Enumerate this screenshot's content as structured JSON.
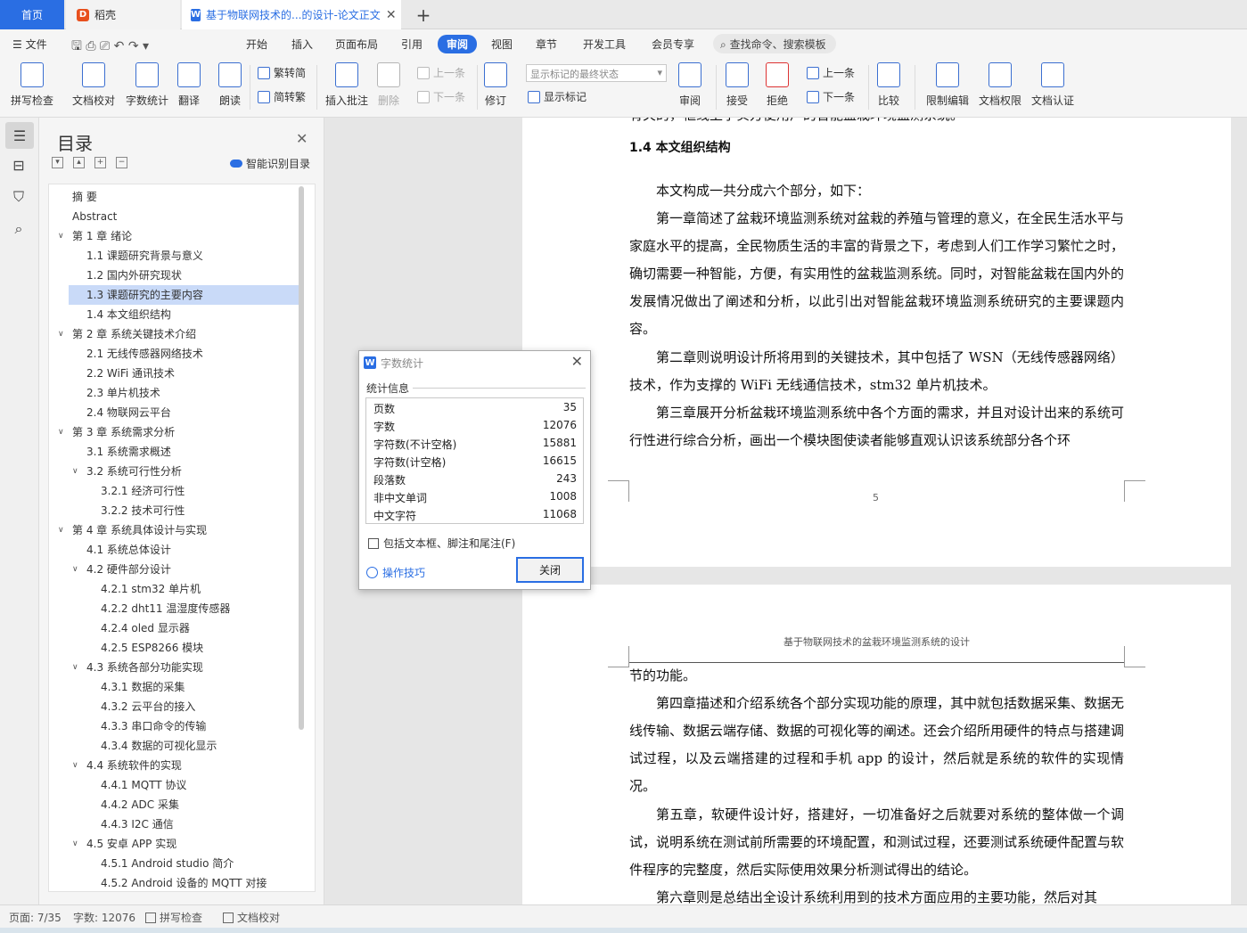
{
  "tabs": {
    "home": "首页",
    "daoke": "稻壳",
    "document": "基于物联网技术的...的设计-论文正文",
    "add": "+",
    "close": "✕"
  },
  "menu": {
    "file": "文件",
    "items": [
      "开始",
      "插入",
      "页面布局",
      "引用",
      "审阅",
      "视图",
      "章节",
      "开发工具",
      "会员专享"
    ],
    "active": "审阅",
    "search": "查找命令、搜索模板"
  },
  "ribbon": {
    "spell_check": "拼写检查",
    "doc_proof": "文档校对",
    "word_count": "字数统计",
    "translate": "翻译",
    "read_aloud": "朗读",
    "trad_to_simp": "繁转简",
    "simp_to_trad": "简转繁",
    "insert_comment": "插入批注",
    "delete": "删除",
    "prev_comment": "上一条",
    "next_comment": "下一条",
    "track_changes": "修订",
    "markup_mode": "显示标记的最终状态",
    "show_markup": "显示标记",
    "review": "审阅",
    "accept": "接受",
    "reject": "拒绝",
    "prev_change": "上一条",
    "next_change": "下一条",
    "compare": "比较",
    "restrict_edit": "限制编辑",
    "doc_permission": "文档权限",
    "doc_certify": "文档认证"
  },
  "toc": {
    "title": "目录",
    "smart": "智能识别目录",
    "items": [
      {
        "label": "摘  要"
      },
      {
        "label": "Abstract"
      },
      {
        "label": "第 1 章  绪论"
      },
      {
        "label": "1.1  课题研究背景与意义"
      },
      {
        "label": "1.2  国内外研究现状"
      },
      {
        "label": "1.3  课题研究的主要内容"
      },
      {
        "label": "1.4  本文组织结构"
      },
      {
        "label": "第 2 章  系统关键技术介绍"
      },
      {
        "label": "2.1  无线传感器网络技术"
      },
      {
        "label": "2.2 WiFi 通讯技术"
      },
      {
        "label": "2.3  单片机技术"
      },
      {
        "label": "2.4  物联网云平台"
      },
      {
        "label": "第 3 章  系统需求分析"
      },
      {
        "label": "3.1  系统需求概述"
      },
      {
        "label": "3.2  系统可行性分析"
      },
      {
        "label": "3.2.1  经济可行性"
      },
      {
        "label": "3.2.2  技术可行性"
      },
      {
        "label": "第 4 章  系统具体设计与实现"
      },
      {
        "label": "4.1  系统总体设计"
      },
      {
        "label": "4.2  硬件部分设计"
      },
      {
        "label": "4.2.1 stm32 单片机"
      },
      {
        "label": "4.2.2 dht11 温湿度传感器"
      },
      {
        "label": "4.2.4 oled 显示器"
      },
      {
        "label": "4.2.5 ESP8266 模块"
      },
      {
        "label": "4.3  系统各部分功能实现"
      },
      {
        "label": "4.3.1 数据的采集"
      },
      {
        "label": "4.3.2 云平台的接入"
      },
      {
        "label": "4.3.3  串口命令的传输"
      },
      {
        "label": "4.3.4 数据的可视化显示"
      },
      {
        "label": "4.4  系统软件的实现"
      },
      {
        "label": "4.4.1 MQTT 协议"
      },
      {
        "label": "4.4.2 ADC 采集"
      },
      {
        "label": "4.4.3 I2C 通信"
      },
      {
        "label": "4.5  安卓 APP 实现"
      },
      {
        "label": "4.5.1    Android studio 简介"
      },
      {
        "label": "4.5.2 Android 设备的 MQTT 对接"
      }
    ]
  },
  "document": {
    "cut_line": "有关的，框线上争实方便用户的智能盆栽环境监测系统。",
    "heading": "1.4  本文组织结构",
    "paragraphs_p1": [
      "本文构成一共分成六个部分，如下：",
      "第一章简述了盆栽环境监测系统对盆栽的养殖与管理的意义，在全民生活水平与家庭水平的提高，全民物质生活的丰富的背景之下，考虑到人们工作学习繁忙之时，确切需要一种智能，方便，有实用性的盆栽监测系统。同时，对智能盆栽在国内外的发展情况做出了阐述和分析，以此引出对智能盆栽环境监测系统研究的主要课题内容。",
      "第二章则说明设计所将用到的关键技术，其中包括了 WSN（无线传感器网络）技术，作为支撑的 WiFi 无线通信技术，stm32 单片机技术。",
      "第三章展开分析盆栽环境监测系统中各个方面的需求，并且对设计出来的系统可行性进行综合分析，画出一个模块图使读者能够直观认识该系统部分各个环"
    ],
    "page_number": "5",
    "header2": "基于物联网技术的盆栽环境监测系统的设计",
    "paragraphs_p2": [
      "节的功能。",
      "第四章描述和介绍系统各个部分实现功能的原理，其中就包括数据采集、数据无线传输、数据云端存储、数据的可视化等的阐述。还会介绍所用硬件的特点与搭建调试过程，以及云端搭建的过程和手机 app 的设计，然后就是系统的软件的实现情况。",
      "第五章，软硬件设计好，搭建好，一切准备好之后就要对系统的整体做一个调试，说明系统在测试前所需要的环境配置，和测试过程，还要测试系统硬件配置与软件程序的完整度，然后实际使用效果分析测试得出的结论。",
      "第六章则是总结出全设计系统利用到的技术方面应用的主要功能，然后对其"
    ]
  },
  "dialog": {
    "title": "字数统计",
    "section": "统计信息",
    "stats": [
      {
        "label": "页数",
        "value": "35"
      },
      {
        "label": "字数",
        "value": "12076"
      },
      {
        "label": "字符数(不计空格)",
        "value": "15881"
      },
      {
        "label": "字符数(计空格)",
        "value": "16615"
      },
      {
        "label": "段落数",
        "value": "243"
      },
      {
        "label": "非中文单词",
        "value": "1008"
      },
      {
        "label": "中文字符",
        "value": "11068"
      }
    ],
    "checkbox": "包括文本框、脚注和尾注(F)",
    "tips": "操作技巧",
    "close": "关闭"
  },
  "status": {
    "page": "页面: 7/35",
    "words": "字数: 12076",
    "spell": "拼写检查",
    "proof": "文档校对"
  }
}
